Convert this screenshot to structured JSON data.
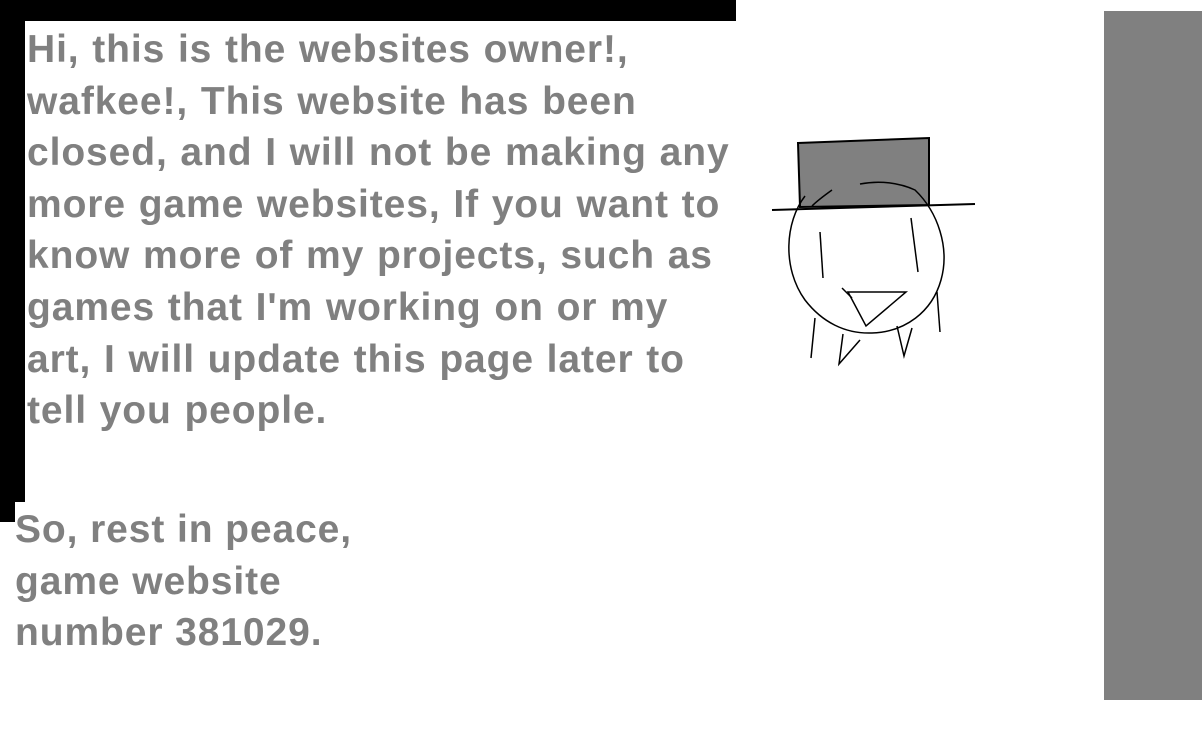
{
  "message": {
    "body": "Hi, this is the websites owner!, wafkee!, This website has been closed, and I will not be making any more game websites, If you want to know more of my projects, such as games that I'm working on or my art, I will update this page later to tell you people."
  },
  "farewell": {
    "line1": "So, rest in peace,",
    "line2": "game website",
    "line3": "number 381029."
  },
  "colors": {
    "text": "#808080",
    "frame": "#000000",
    "side_panel": "#808080",
    "background": "#ffffff"
  }
}
